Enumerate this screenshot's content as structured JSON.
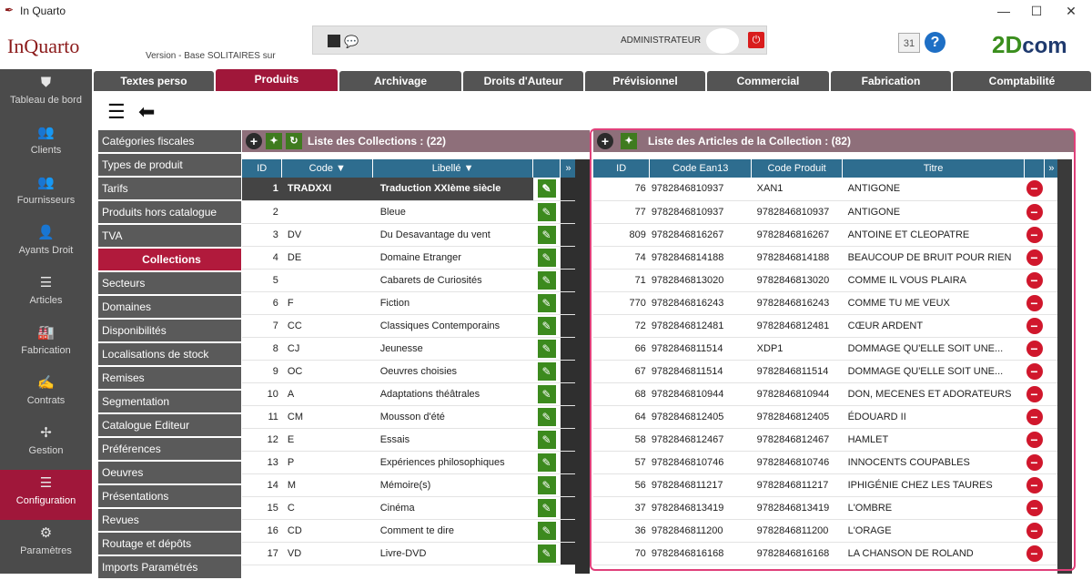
{
  "window": {
    "title": "In Quarto",
    "minimize": "—",
    "maximize": "☐",
    "close": "✕"
  },
  "header": {
    "logo": "InQuarto",
    "version": "Version  - Base SOLITAIRES sur",
    "user": "ADMINISTRATEUR",
    "power": "⏻",
    "calendar": "31",
    "help": "?",
    "brand_main": "2D",
    "brand_suffix": "com"
  },
  "sidebar": [
    {
      "label": "Tableau de bord",
      "icon": "shield-icon",
      "glyph": "⛊"
    },
    {
      "label": "Clients",
      "icon": "clients-icon",
      "glyph": "👥"
    },
    {
      "label": "Fournisseurs",
      "icon": "suppliers-icon",
      "glyph": "👥"
    },
    {
      "label": "Ayants Droit",
      "icon": "person-icon",
      "glyph": "👤"
    },
    {
      "label": "Articles",
      "icon": "books-icon",
      "glyph": "☰"
    },
    {
      "label": "Fabrication",
      "icon": "factory-icon",
      "glyph": "🏭"
    },
    {
      "label": "Contrats",
      "icon": "handshake-icon",
      "glyph": "✍"
    },
    {
      "label": "Gestion",
      "icon": "network-icon",
      "glyph": "✢"
    },
    {
      "label": "Configuration",
      "icon": "sliders-icon",
      "glyph": "☰",
      "active": true
    },
    {
      "label": "Paramètres",
      "icon": "gears-icon",
      "glyph": "⚙"
    }
  ],
  "tabs": [
    {
      "label": "Textes perso"
    },
    {
      "label": "Produits",
      "active": true
    },
    {
      "label": "Archivage"
    },
    {
      "label": "Droits d'Auteur"
    },
    {
      "label": "Prévisionnel"
    },
    {
      "label": "Commercial"
    },
    {
      "label": "Fabrication"
    },
    {
      "label": "Comptabilité"
    }
  ],
  "menu": [
    "Catégories fiscales",
    "Types de produit",
    "Tarifs",
    "Produits hors catalogue",
    "TVA",
    "Collections",
    "Secteurs",
    "Domaines",
    "Disponibilités",
    "Localisations de stock",
    "Remises",
    "Segmentation",
    "Catalogue Editeur",
    "Préférences",
    "Oeuvres",
    "Présentations",
    "Revues",
    "Routage et dépôts",
    "Imports Paramétrés"
  ],
  "menu_active": "Collections",
  "collections": {
    "title": "Liste des Collections : (22)",
    "headers": [
      "ID",
      "Code",
      "Libellé"
    ],
    "rows": [
      [
        "1",
        "TRADXXI",
        "Traduction XXIème siècle"
      ],
      [
        "2",
        "",
        "Bleue"
      ],
      [
        "3",
        "DV",
        "Du Desavantage du vent"
      ],
      [
        "4",
        "DE",
        "Domaine Etranger"
      ],
      [
        "5",
        "",
        "Cabarets de Curiosités"
      ],
      [
        "6",
        "F",
        "Fiction"
      ],
      [
        "7",
        "CC",
        "Classiques Contemporains"
      ],
      [
        "8",
        "CJ",
        "Jeunesse"
      ],
      [
        "9",
        "OC",
        "Oeuvres choisies"
      ],
      [
        "10",
        "A",
        "Adaptations théâtrales"
      ],
      [
        "11",
        "CM",
        "Mousson d'été"
      ],
      [
        "12",
        "E",
        "Essais"
      ],
      [
        "13",
        "P",
        "Expériences philosophiques"
      ],
      [
        "14",
        "M",
        "Mémoire(s)"
      ],
      [
        "15",
        "C",
        "Cinéma"
      ],
      [
        "16",
        "CD",
        "Comment te dire"
      ],
      [
        "17",
        "VD",
        "Livre-DVD"
      ]
    ]
  },
  "articles": {
    "title": "Liste des Articles de la Collection : (82)",
    "headers": [
      "ID",
      "Code Ean13",
      "Code Produit",
      "Titre"
    ],
    "rows": [
      [
        "76",
        "9782846810937",
        "XAN1",
        "ANTIGONE"
      ],
      [
        "77",
        "9782846810937",
        "9782846810937",
        "ANTIGONE"
      ],
      [
        "809",
        "9782846816267",
        "9782846816267",
        "ANTOINE ET CLEOPATRE"
      ],
      [
        "74",
        "9782846814188",
        "9782846814188",
        "BEAUCOUP DE BRUIT POUR RIEN"
      ],
      [
        "71",
        "9782846813020",
        "9782846813020",
        "COMME IL VOUS PLAIRA"
      ],
      [
        "770",
        "9782846816243",
        "9782846816243",
        "COMME TU ME VEUX"
      ],
      [
        "72",
        "9782846812481",
        "9782846812481",
        "CŒUR ARDENT"
      ],
      [
        "66",
        "9782846811514",
        "XDP1",
        "DOMMAGE QU'ELLE SOIT UNE..."
      ],
      [
        "67",
        "9782846811514",
        "9782846811514",
        "DOMMAGE QU'ELLE SOIT UNE..."
      ],
      [
        "68",
        "9782846810944",
        "9782846810944",
        "DON, MECENES ET ADORATEURS"
      ],
      [
        "64",
        "9782846812405",
        "9782846812405",
        "ÉDOUARD II"
      ],
      [
        "58",
        "9782846812467",
        "9782846812467",
        "HAMLET"
      ],
      [
        "57",
        "9782846810746",
        "9782846810746",
        "INNOCENTS COUPABLES"
      ],
      [
        "56",
        "9782846811217",
        "9782846811217",
        "IPHIGÉNIE CHEZ LES TAURES"
      ],
      [
        "37",
        "9782846813419",
        "9782846813419",
        "L'OMBRE"
      ],
      [
        "36",
        "9782846811200",
        "9782846811200",
        "L'ORAGE"
      ],
      [
        "70",
        "9782846816168",
        "9782846816168",
        "LA CHANSON DE ROLAND"
      ]
    ]
  },
  "colors": {
    "accent": "#a0173a",
    "sidebar": "#4b4b4b",
    "table_header": "#2e6d8f",
    "panel_header": "#8e6f7a"
  }
}
